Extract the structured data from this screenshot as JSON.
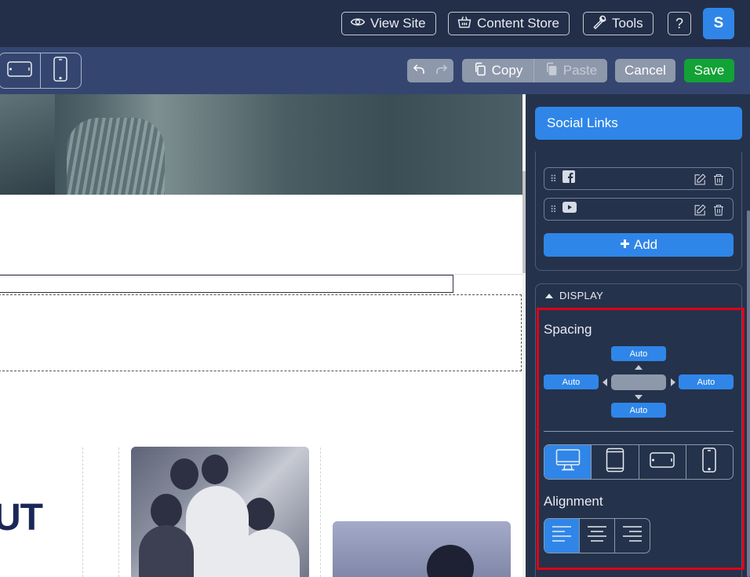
{
  "header": {
    "view_site": "View Site",
    "content_store": "Content Store",
    "tools": "Tools",
    "help": "?",
    "user_initial": "S"
  },
  "toolbar": {
    "copy": "Copy",
    "paste": "Paste",
    "cancel": "Cancel",
    "save": "Save"
  },
  "canvas": {
    "heading_fragment": "UT"
  },
  "panel": {
    "title": "Social Links",
    "links": [
      {
        "icon": "facebook-icon"
      },
      {
        "icon": "youtube-icon"
      }
    ],
    "add_label": "Add",
    "display": {
      "header": "DISPLAY",
      "spacing_label": "Spacing",
      "spacing": {
        "top": "Auto",
        "left": "Auto",
        "right": "Auto",
        "bottom": "Auto"
      },
      "active_device": "desktop",
      "alignment_label": "Alignment",
      "active_alignment": "left"
    }
  },
  "colors": {
    "accent": "#2f86e8",
    "save": "#12a235",
    "highlight": "#e00015",
    "header_bg": "#232f48",
    "toolbar_bg": "#344670",
    "heading_text": "#1b2757"
  }
}
